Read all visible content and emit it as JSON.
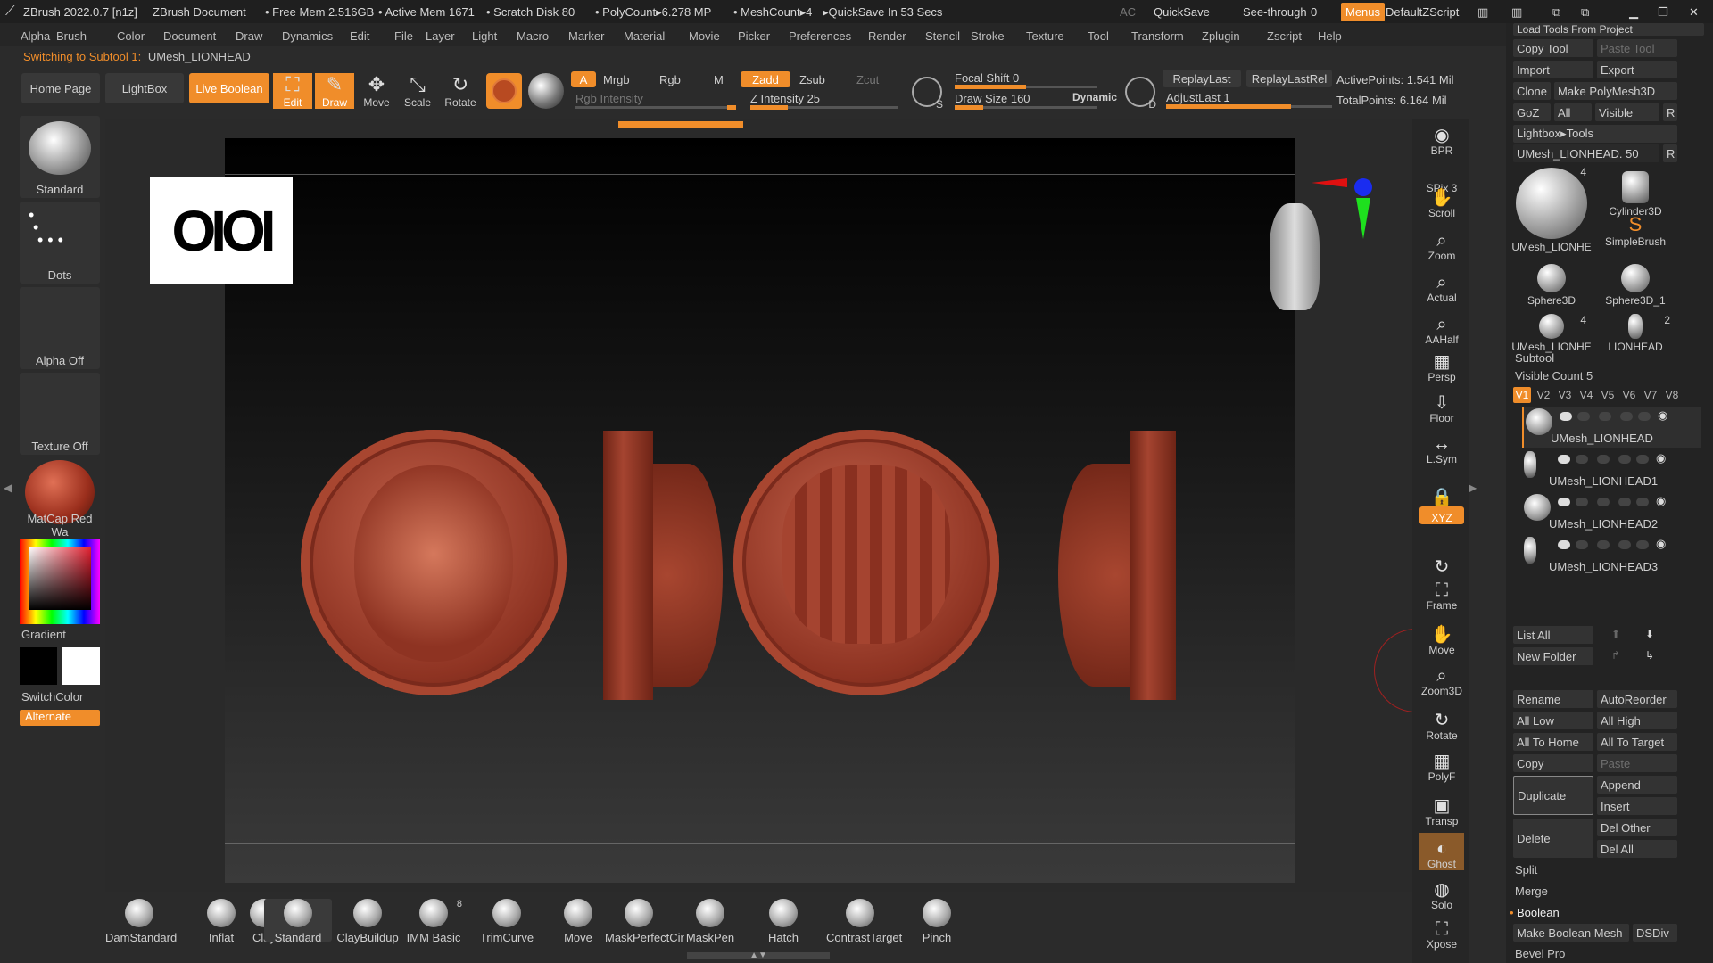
{
  "titlebar": {
    "app": "ZBrush 2022.0.7 [n1z]",
    "document": "ZBrush Document",
    "free_mem": "• Free Mem 2.516GB",
    "active_mem": "• Active Mem 1671",
    "scratch": "• Scratch Disk 80",
    "polycount": "• PolyCount▸6.278 MP",
    "meshcount": "• MeshCount▸4",
    "quicksave_info": "▸QuickSave In 53 Secs",
    "ac": "AC",
    "quicksave": "QuickSave",
    "see_through": "See-through",
    "see_through_val": "0",
    "menus": "Menus",
    "zscript": "DefaultZScript"
  },
  "menus": [
    "Alpha",
    "Brush",
    "Color",
    "Document",
    "Draw",
    "Dynamics",
    "Edit",
    "File",
    "Layer",
    "Light",
    "Macro",
    "Marker",
    "Material",
    "Movie",
    "Picker",
    "Preferences",
    "Render",
    "Stencil",
    "Stroke",
    "Texture",
    "Tool",
    "Transform",
    "Zplugin",
    "Zscript",
    "Help"
  ],
  "status": {
    "switching": "Switching to Subtool 1:",
    "subtool_name": "UMesh_LIONHEAD"
  },
  "topshelf": {
    "home": "Home Page",
    "lightbox": "LightBox",
    "live_boolean": "Live Boolean",
    "edit": "Edit",
    "draw": "Draw",
    "move": "Move",
    "scale": "Scale",
    "rotate": "Rotate",
    "a": "A",
    "mrgb": "Mrgb",
    "rgb": "Rgb",
    "m": "M",
    "rgb_intensity": "Rgb Intensity",
    "zadd": "Zadd",
    "zsub": "Zsub",
    "zcut": "Zcut",
    "z_intensity": "Z Intensity 25",
    "focal_shift": "Focal Shift 0",
    "draw_size": "Draw Size 160",
    "dynamic": "Dynamic",
    "replay_last": "ReplayLast",
    "replay_last_rel": "ReplayLastRel",
    "adjust_last": "AdjustLast 1",
    "active_points": "ActivePoints: 1.541 Mil",
    "total_points": "TotalPoints: 6.164 Mil",
    "z_intensity_level": 0.25,
    "draw_size_level": 0.2,
    "focal_level": 0.5,
    "adjust_level": 0.75
  },
  "leftpanel": {
    "brush": "Standard",
    "stroke": "Dots",
    "alpha": "Alpha Off",
    "texture": "Texture Off",
    "material": "MatCap Red Wa",
    "gradient": "Gradient",
    "switch_color": "SwitchColor",
    "alternate": "Alternate"
  },
  "canvas": {
    "logo_text": "OIOI"
  },
  "rightbar": [
    "BPR",
    "SPix 3",
    "Scroll",
    "Zoom",
    "Actual",
    "AAHalf",
    "Persp",
    "Floor",
    "L.Sym",
    "",
    "XYZ",
    "",
    "Frame",
    "Move",
    "Zoom3D",
    "Rotate",
    "PolyF",
    "Transp",
    "Ghost",
    "Solo",
    "Xpose"
  ],
  "toolpanel": {
    "load_tools": "Load Tools From Project",
    "copy_tool": "Copy Tool",
    "paste_tool": "Paste Tool",
    "import": "Import",
    "export": "Export",
    "clone": "Clone",
    "make_polymesh": "Make PolyMesh3D",
    "goz": "GoZ",
    "all": "All",
    "visible": "Visible",
    "r": "R",
    "lightbox_tools": "Lightbox▸Tools",
    "current_tool": "UMesh_LIONHEAD. 50",
    "thumbs": [
      {
        "label": "UMesh_LIONHE",
        "count": "4"
      },
      {
        "label": "Cylinder3D",
        "count": ""
      },
      {
        "label": "SimpleBrush",
        "count": ""
      },
      {
        "label": "Sphere3D",
        "count": ""
      },
      {
        "label": "Sphere3D_1",
        "count": ""
      },
      {
        "label": "UMesh_LIONHE",
        "count": "4"
      },
      {
        "label": "LIONHEAD",
        "count": "2"
      }
    ],
    "subtool": "Subtool",
    "visible_count": "Visible Count 5",
    "versions": [
      "V1",
      "V2",
      "V3",
      "V4",
      "V5",
      "V6",
      "V7",
      "V8"
    ],
    "subtools": [
      "UMesh_LIONHEAD",
      "UMesh_LIONHEAD1",
      "UMesh_LIONHEAD2",
      "UMesh_LIONHEAD3"
    ],
    "list_all": "List All",
    "new_folder": "New Folder",
    "rename": "Rename",
    "auto_reorder": "AutoReorder",
    "all_low": "All Low",
    "all_high": "All High",
    "all_to_home": "All To Home",
    "all_to_target": "All To Target",
    "copy": "Copy",
    "paste": "Paste",
    "duplicate": "Duplicate",
    "append": "Append",
    "insert": "Insert",
    "delete": "Delete",
    "del_other": "Del Other",
    "del_all": "Del All",
    "split": "Split",
    "merge": "Merge",
    "boolean": "Boolean",
    "make_boolean_mesh": "Make Boolean Mesh",
    "dsdiv": "DSDiv",
    "bevel_pro": "Bevel Pro"
  },
  "bottomshelf": [
    {
      "label": "DamStandard",
      "badge": ""
    },
    {
      "label": "Inflat",
      "badge": ""
    },
    {
      "label": "Clay",
      "badge": ""
    },
    {
      "label": "Standard",
      "badge": ""
    },
    {
      "label": "ClayBuildup",
      "badge": ""
    },
    {
      "label": "IMM Basic",
      "badge": "8"
    },
    {
      "label": "TrimCurve",
      "badge": ""
    },
    {
      "label": "Move",
      "badge": ""
    },
    {
      "label": "MaskPerfectCir",
      "badge": ""
    },
    {
      "label": "MaskPen",
      "badge": ""
    },
    {
      "label": "Hatch",
      "badge": ""
    },
    {
      "label": "ContrastTarget",
      "badge": ""
    },
    {
      "label": "Pinch",
      "badge": ""
    }
  ],
  "colors": {
    "accent": "#f08d2a",
    "model": "#a84630",
    "panel": "#232323"
  }
}
